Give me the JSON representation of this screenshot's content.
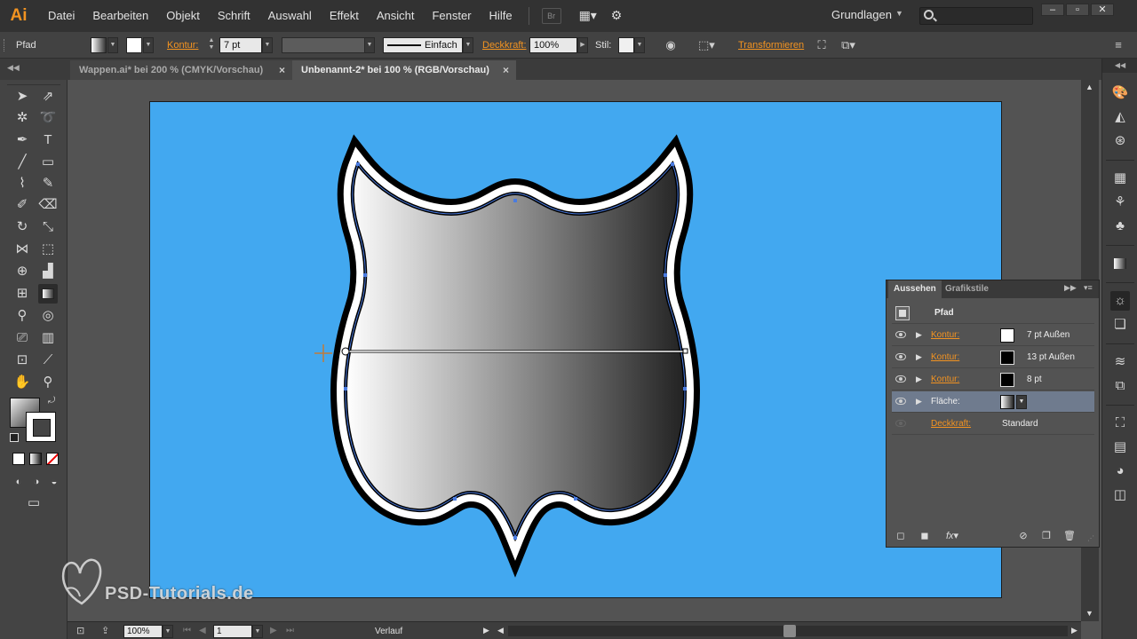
{
  "app": {
    "logo": "Ai"
  },
  "menu": [
    "Datei",
    "Bearbeiten",
    "Objekt",
    "Schrift",
    "Auswahl",
    "Effekt",
    "Ansicht",
    "Fenster",
    "Hilfe"
  ],
  "menubar": {
    "bridge_label": "Br",
    "workspace": "Grundlagen",
    "search_placeholder": ""
  },
  "window_controls": {
    "minimize": "–",
    "maximize": "▫",
    "close": "✕"
  },
  "control_bar": {
    "object_type": "Pfad",
    "stroke_link": "Kontur:",
    "stroke_weight": "7 pt",
    "stroke_profile": "Einfach",
    "opacity_link": "Deckkraft:",
    "opacity_value": "100%",
    "style_label": "Stil:",
    "transform_link": "Transformieren"
  },
  "tabs": [
    {
      "label": "Wappen.ai* bei 200 % (CMYK/Vorschau)",
      "active": false,
      "close": "×"
    },
    {
      "label": "Unbenannt-2* bei 100 % (RGB/Vorschau)",
      "active": true,
      "close": "×"
    }
  ],
  "toolbox_icons": [
    "selection-tool",
    "direct-selection-tool",
    "magic-wand-tool",
    "lasso-tool",
    "pen-tool",
    "type-tool",
    "line-tool",
    "rectangle-tool",
    "paintbrush-tool",
    "pencil-tool",
    "blob-brush-tool",
    "eraser-tool",
    "rotate-tool",
    "scale-tool",
    "width-tool",
    "free-transform-tool",
    "shape-builder-tool",
    "perspective-grid-tool",
    "mesh-tool",
    "gradient-tool",
    "eyedropper-tool",
    "blend-tool",
    "symbol-sprayer-tool",
    "column-graph-tool",
    "artboard-tool",
    "slice-tool",
    "hand-tool",
    "zoom-tool"
  ],
  "appearance_panel": {
    "tabs": [
      "Aussehen",
      "Grafikstile"
    ],
    "object": "Pfad",
    "rows": [
      {
        "label": "Kontur:",
        "link": true,
        "swatch": "#ffffff",
        "value": "7 pt  Außen"
      },
      {
        "label": "Kontur:",
        "link": true,
        "swatch": "#000000",
        "value": "13 pt  Außen"
      },
      {
        "label": "Kontur:",
        "link": true,
        "swatch": "#000000",
        "value": "8 pt"
      },
      {
        "label": "Fläche:",
        "link": false,
        "swatch": "gradient",
        "value": "",
        "selected": true
      },
      {
        "label": "Deckkraft:",
        "link": true,
        "swatch": "",
        "value": "Standard"
      }
    ],
    "footer_icons": [
      "add-stroke-icon",
      "add-fill-icon",
      "fx-icon",
      "clear-appearance-icon",
      "duplicate-item-icon",
      "delete-item-icon"
    ]
  },
  "status_bar": {
    "zoom": "100%",
    "artboard_number": "1",
    "tool_status": "Verlauf"
  },
  "watermark": {
    "text": "PSD-Tutorials.de"
  },
  "colors": {
    "artboard": "#42a8f0",
    "accent": "#f29321",
    "selected_row": "#6f7b8e"
  }
}
